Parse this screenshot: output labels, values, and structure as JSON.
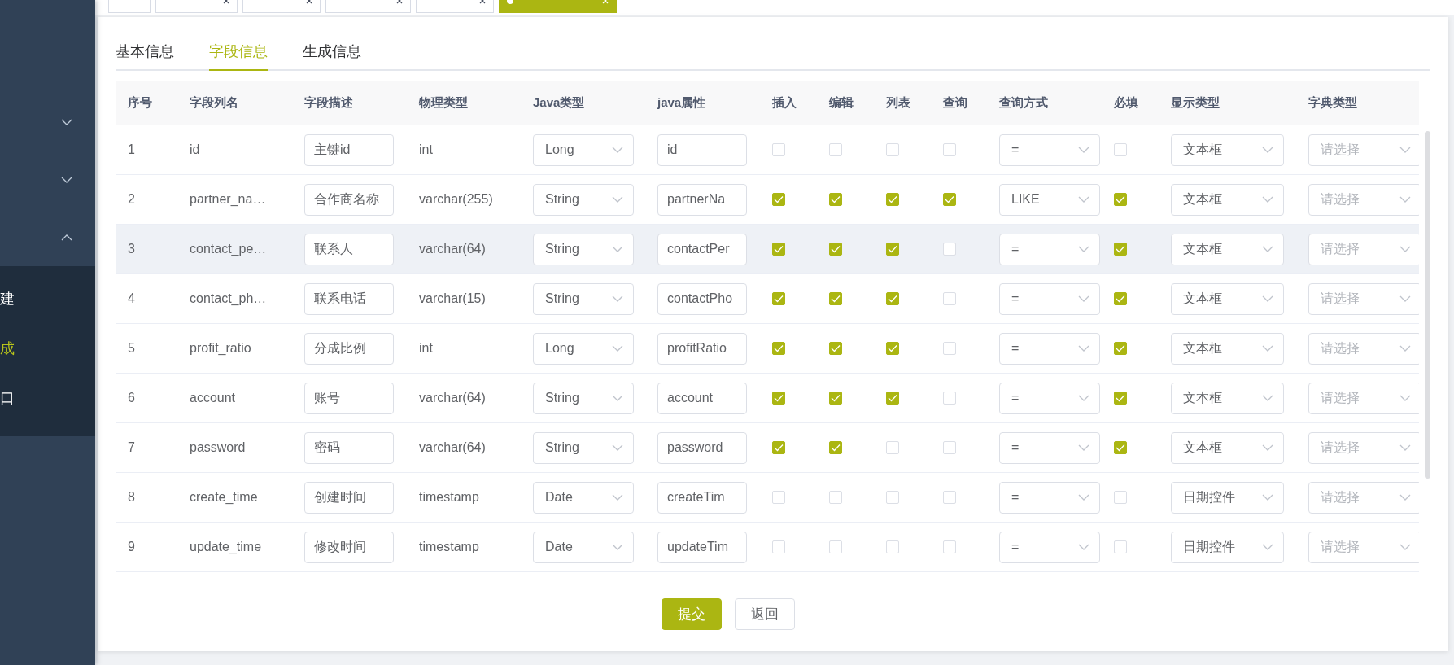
{
  "tag_bar": {
    "tags": [
      {
        "closable": false,
        "selected": false
      },
      {
        "closable": true,
        "selected": false
      },
      {
        "closable": true,
        "selected": false
      },
      {
        "closable": true,
        "selected": false
      },
      {
        "closable": true,
        "selected": false
      },
      {
        "closable": true,
        "selected": true
      }
    ]
  },
  "sidebar": {
    "groups": [
      {
        "expanded": false
      },
      {
        "expanded": false
      },
      {
        "expanded": true
      }
    ],
    "items": [
      {
        "label": "建",
        "selected": false
      },
      {
        "label": "成",
        "selected": true
      },
      {
        "label": "口",
        "selected": false
      }
    ]
  },
  "tabs": [
    {
      "label": "基本信息",
      "selected": false
    },
    {
      "label": "字段信息",
      "selected": true
    },
    {
      "label": "生成信息",
      "selected": false
    }
  ],
  "table": {
    "columns": [
      "序号",
      "字段列名",
      "字段描述",
      "物理类型",
      "Java类型",
      "java属性",
      "插入",
      "编辑",
      "列表",
      "查询",
      "查询方式",
      "必填",
      "显示类型",
      "字典类型"
    ],
    "rows": [
      {
        "index": "1",
        "column_name": "id",
        "description": "主键id",
        "physical_type": "int",
        "java_type": "Long",
        "java_field": "id",
        "insert": false,
        "edit": false,
        "list": false,
        "query": false,
        "query_mode": "=",
        "required": false,
        "display_type": "文本框",
        "dict_type_placeholder": "请选择",
        "highlighted": false
      },
      {
        "index": "2",
        "column_name": "partner_na…",
        "description": "合作商名称",
        "physical_type": "varchar(255)",
        "java_type": "String",
        "java_field": "partnerNa",
        "insert": true,
        "edit": true,
        "list": true,
        "query": true,
        "query_mode": "LIKE",
        "required": true,
        "display_type": "文本框",
        "dict_type_placeholder": "请选择",
        "highlighted": false
      },
      {
        "index": "3",
        "column_name": "contact_pe…",
        "description": "联系人",
        "physical_type": "varchar(64)",
        "java_type": "String",
        "java_field": "contactPer",
        "insert": true,
        "edit": true,
        "list": true,
        "query": false,
        "query_mode": "=",
        "required": true,
        "display_type": "文本框",
        "dict_type_placeholder": "请选择",
        "highlighted": true
      },
      {
        "index": "4",
        "column_name": "contact_ph…",
        "description": "联系电话",
        "physical_type": "varchar(15)",
        "java_type": "String",
        "java_field": "contactPho",
        "insert": true,
        "edit": true,
        "list": true,
        "query": false,
        "query_mode": "=",
        "required": true,
        "display_type": "文本框",
        "dict_type_placeholder": "请选择",
        "highlighted": false
      },
      {
        "index": "5",
        "column_name": "profit_ratio",
        "description": "分成比例",
        "physical_type": "int",
        "java_type": "Long",
        "java_field": "profitRatio",
        "insert": true,
        "edit": true,
        "list": true,
        "query": false,
        "query_mode": "=",
        "required": true,
        "display_type": "文本框",
        "dict_type_placeholder": "请选择",
        "highlighted": false
      },
      {
        "index": "6",
        "column_name": "account",
        "description": "账号",
        "physical_type": "varchar(64)",
        "java_type": "String",
        "java_field": "account",
        "insert": true,
        "edit": true,
        "list": true,
        "query": false,
        "query_mode": "=",
        "required": true,
        "display_type": "文本框",
        "dict_type_placeholder": "请选择",
        "highlighted": false
      },
      {
        "index": "7",
        "column_name": "password",
        "description": "密码",
        "physical_type": "varchar(64)",
        "java_type": "String",
        "java_field": "password",
        "insert": true,
        "edit": true,
        "list": false,
        "query": false,
        "query_mode": "=",
        "required": true,
        "display_type": "文本框",
        "dict_type_placeholder": "请选择",
        "highlighted": false
      },
      {
        "index": "8",
        "column_name": "create_time",
        "description": "创建时间",
        "physical_type": "timestamp",
        "java_type": "Date",
        "java_field": "createTim",
        "insert": false,
        "edit": false,
        "list": false,
        "query": false,
        "query_mode": "=",
        "required": false,
        "display_type": "日期控件",
        "dict_type_placeholder": "请选择",
        "highlighted": false
      },
      {
        "index": "9",
        "column_name": "update_time",
        "description": "修改时间",
        "physical_type": "timestamp",
        "java_type": "Date",
        "java_field": "updateTim",
        "insert": false,
        "edit": false,
        "list": false,
        "query": false,
        "query_mode": "=",
        "required": false,
        "display_type": "日期控件",
        "dict_type_placeholder": "请选择",
        "highlighted": false
      }
    ]
  },
  "buttons": [
    {
      "label": "提交",
      "kind": "primary"
    },
    {
      "label": "返回",
      "kind": "default"
    }
  ]
}
